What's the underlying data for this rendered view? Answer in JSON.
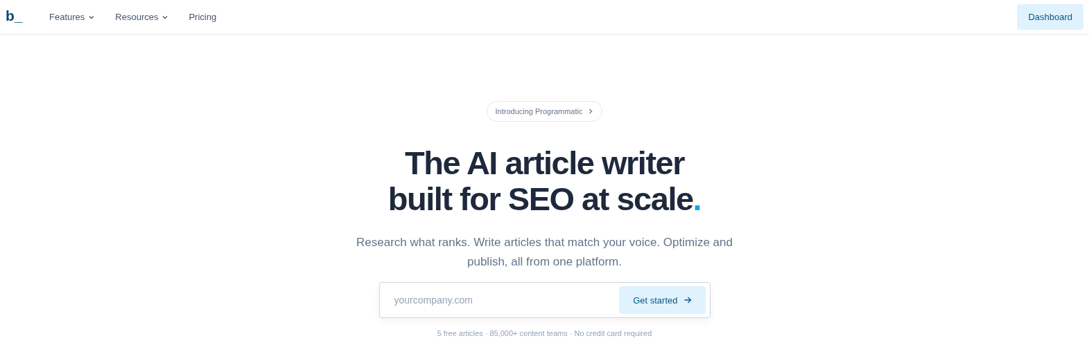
{
  "nav": {
    "logo": "b_",
    "items": [
      {
        "label": "Features",
        "kind": "dropdown"
      },
      {
        "label": "Resources",
        "kind": "dropdown"
      },
      {
        "label": "Pricing",
        "kind": "link"
      }
    ],
    "dashboard": "Dashboard"
  },
  "hero": {
    "badge": "Introducing Programmatic",
    "headline": {
      "lines": [
        "The AI article writer",
        "built for SEO at scale"
      ],
      "accent": "."
    },
    "subtitle": "Research what ranks. Write articles that match your voice. Optimize and publish, all from one platform.",
    "form": {
      "placeholder": "yourcompany.com",
      "button": "Get started"
    },
    "footnote": "5 free articles · 85,000+ content teams · No credit card required"
  }
}
